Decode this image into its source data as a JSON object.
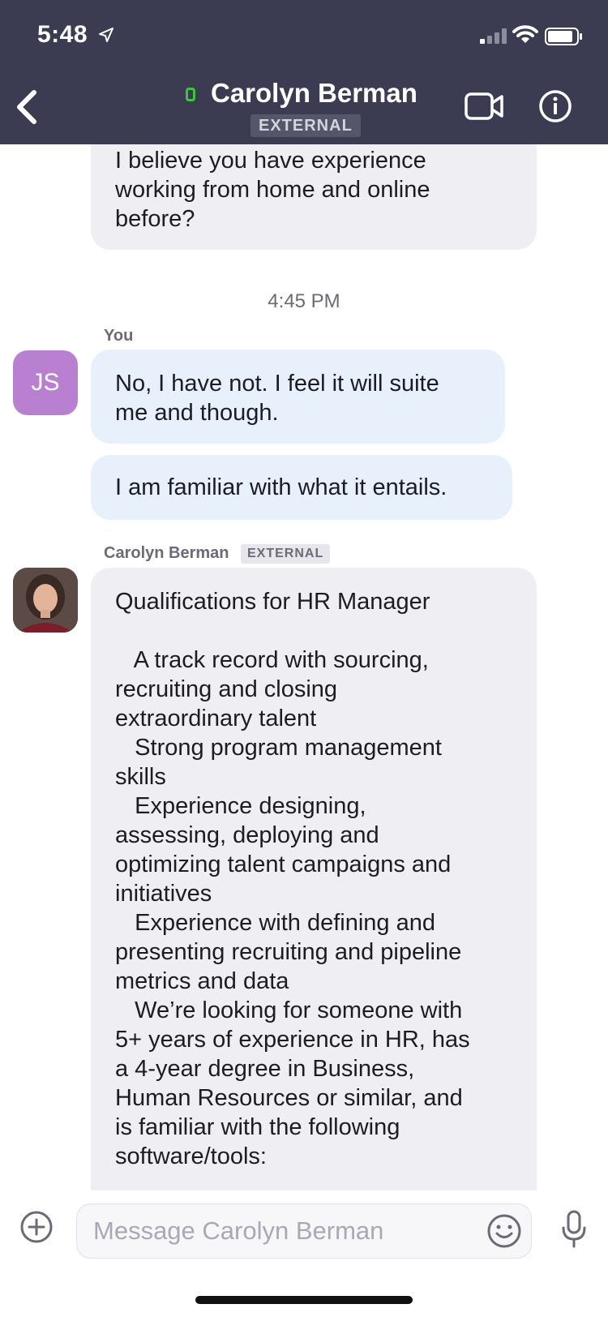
{
  "status_bar": {
    "time": "5:48"
  },
  "header": {
    "title": "Carolyn Berman",
    "badge": "EXTERNAL",
    "presence_color": "#3ec43e",
    "background": "#3b3c51"
  },
  "messages": {
    "m1": {
      "lines": [
        "I believe you have experience",
        "working from home and online",
        "before?"
      ]
    },
    "time_separator": "4:45 PM",
    "you_label": "You",
    "you_avatar": "JS",
    "m2": {
      "lines": [
        "No, I have not. I feel it will suite",
        "me and though."
      ]
    },
    "m3": {
      "text": "I am familiar with what it entails."
    },
    "carolyn_label": "Carolyn Berman",
    "carolyn_badge": "EXTERNAL",
    "m4": {
      "lines": [
        "Qualifications for HR Manager",
        "",
        "   A track record with sourcing,",
        "recruiting and closing",
        "extraordinary talent",
        "   Strong program management",
        "skills",
        "   Experience designing,",
        "assessing, deploying and",
        "optimizing talent campaigns and",
        "initiatives",
        "   Experience with defining and",
        "presenting recruiting and pipeline",
        "metrics and data",
        "   We’re looking for someone with",
        "5+ years of experience in HR, has",
        "a 4-year degree in Business,",
        "Human Resources or similar, and",
        "is familiar with the following",
        "software/tools:"
      ]
    }
  },
  "composer": {
    "placeholder": "Message Carolyn Berman"
  },
  "icons": {
    "back": "chevron-left-icon",
    "video": "video-camera-icon",
    "info": "info-icon",
    "add": "plus-circle-icon",
    "emoji": "smiley-icon",
    "mic": "microphone-icon"
  }
}
